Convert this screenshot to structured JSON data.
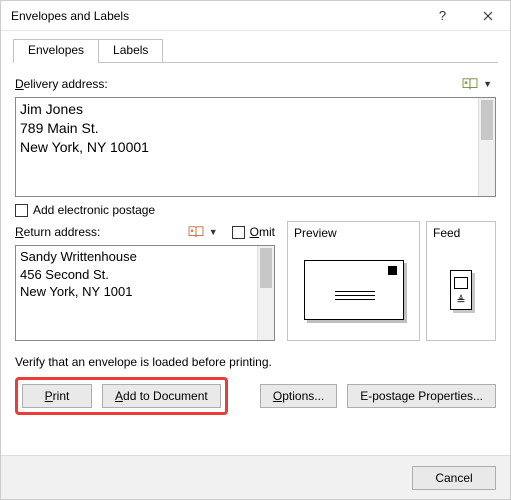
{
  "title": "Envelopes and Labels",
  "tabs": {
    "envelopes": "Envelopes",
    "labels": "Labels"
  },
  "delivery": {
    "label_pre": "",
    "label_u": "D",
    "label_post": "elivery address:",
    "value": "Jim Jones\n789 Main St.\nNew York, NY 10001"
  },
  "electronic_postage": {
    "checked": false,
    "label_pre": "Add ele",
    "label_u": "c",
    "label_post": "tronic postage"
  },
  "return": {
    "label_u": "R",
    "label_post": "eturn address:",
    "omit_u": "O",
    "omit_post": "mit",
    "value": "Sandy Writtenhouse\n456 Second St.\nNew York, NY 1001"
  },
  "preview": {
    "title": "Preview"
  },
  "feed": {
    "title": "Feed"
  },
  "verify": "Verify that an envelope is loaded before printing.",
  "buttons": {
    "print_u": "P",
    "print_post": "rint",
    "add_pre": "",
    "add_u": "A",
    "add_post": "dd to Document",
    "options_u": "O",
    "options_post": "ptions...",
    "epost_pre": "E-posta",
    "epost_u": "g",
    "epost_post": "e Properties...",
    "cancel": "Cancel"
  }
}
